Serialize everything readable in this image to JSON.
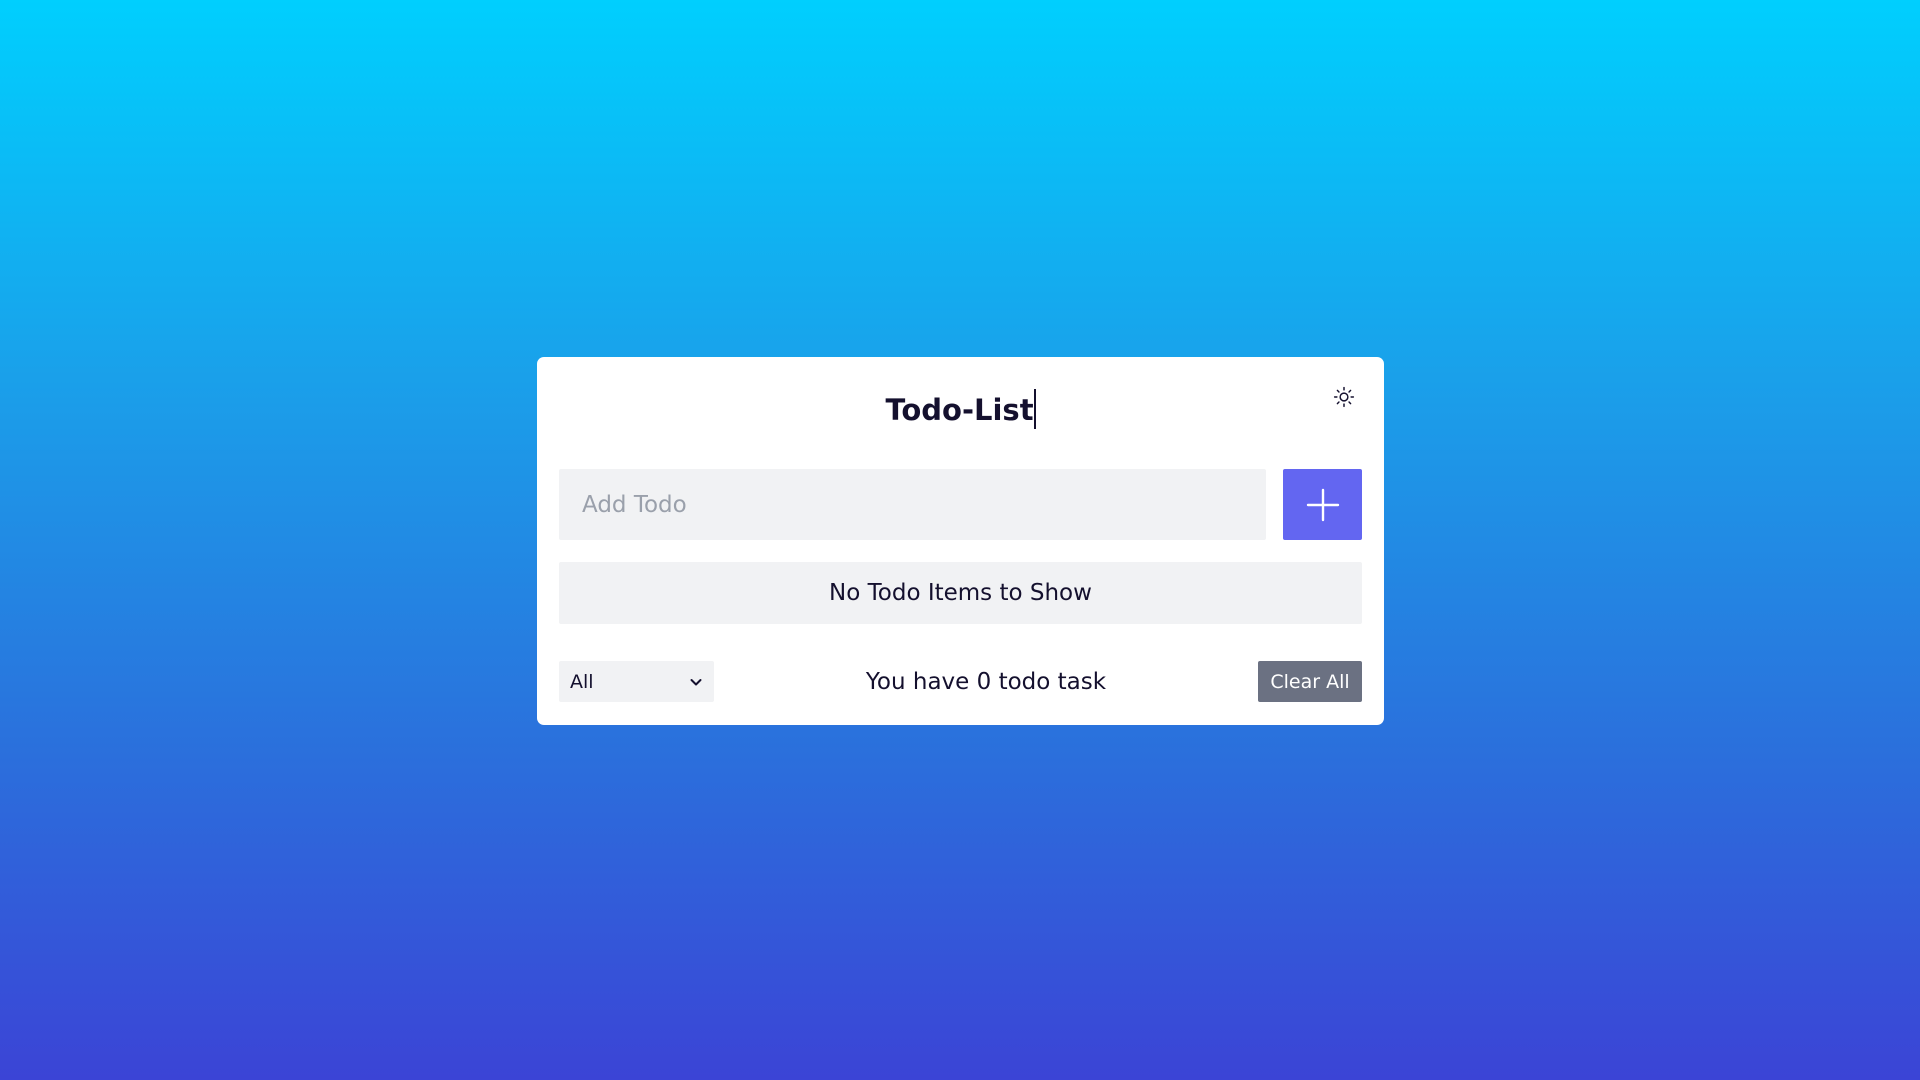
{
  "app": {
    "title": "Todo-List",
    "theme_icon": "sun-icon"
  },
  "add_todo": {
    "placeholder": "Add Todo",
    "value": "",
    "button_icon": "plus-icon"
  },
  "list": {
    "empty_message": "No Todo Items to Show",
    "items": []
  },
  "footer": {
    "filter": {
      "selected": "All",
      "icon": "chevron-down-icon"
    },
    "task_count_text": "You have 0 todo task",
    "clear_label": "Clear All"
  },
  "colors": {
    "accent": "#6366f1",
    "clear_button": "#6b7182",
    "text": "#14102e",
    "field_bg": "#f1f2f4"
  }
}
